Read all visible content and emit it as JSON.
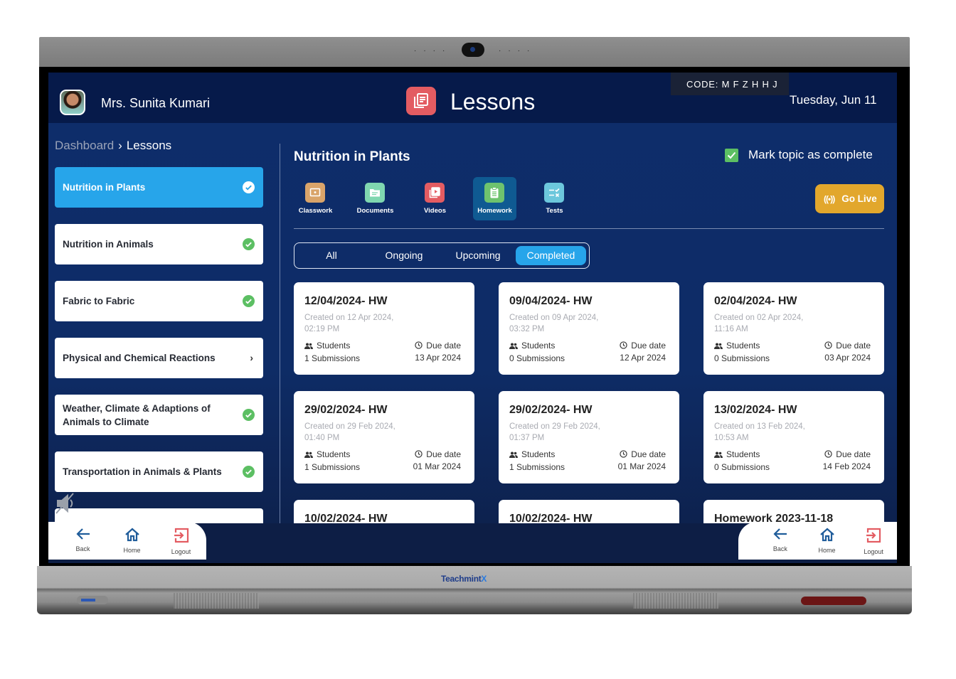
{
  "device": {
    "brand": "Teachmint",
    "brand_suffix": "X"
  },
  "header": {
    "teacher_name": "Mrs. Sunita Kumari",
    "page_title": "Lessons",
    "class_code": "CODE:  M F Z H H J",
    "date": "Tuesday, Jun 11"
  },
  "breadcrumb": {
    "root": "Dashboard",
    "separator": "›",
    "current": "Lessons"
  },
  "topics": [
    {
      "label": "Nutrition in Plants",
      "state": "completed",
      "active": true
    },
    {
      "label": "Nutrition in Animals",
      "state": "completed",
      "active": false
    },
    {
      "label": "Fabric to Fabric",
      "state": "completed",
      "active": false
    },
    {
      "label": "Physical and Chemical Reactions",
      "state": "open",
      "active": false
    },
    {
      "label": "Weather, Climate & Adaptions of Animals to Climate",
      "state": "completed",
      "active": false
    },
    {
      "label": "Transportation in Animals & Plants",
      "state": "completed",
      "active": false
    }
  ],
  "main": {
    "section_title": "Nutrition in Plants",
    "mark_complete_label": "Mark topic as complete",
    "mark_complete_checked": true,
    "go_live_label": "Go Live",
    "resource_tabs": [
      {
        "label": "Classwork",
        "icon": "classwork-icon",
        "color": "#d9a46a",
        "active": false
      },
      {
        "label": "Documents",
        "icon": "documents-icon",
        "color": "#7fd7b0",
        "active": false
      },
      {
        "label": "Videos",
        "icon": "videos-icon",
        "color": "#e35c62",
        "active": false
      },
      {
        "label": "Homework",
        "icon": "homework-icon",
        "color": "#6ec36e",
        "active": true
      },
      {
        "label": "Tests",
        "icon": "tests-icon",
        "color": "#6cc7dc",
        "active": false
      }
    ],
    "filters": [
      {
        "label": "All",
        "active": false
      },
      {
        "label": "Ongoing",
        "active": false
      },
      {
        "label": "Upcoming",
        "active": false
      },
      {
        "label": "Completed",
        "active": true
      }
    ],
    "students_label": "Students",
    "due_label": "Due date",
    "cards": [
      {
        "title": "12/04/2024- HW",
        "created": "Created on 12 Apr 2024, 02:19 PM",
        "submissions": "1 Submissions",
        "due": "13 Apr 2024"
      },
      {
        "title": "09/04/2024- HW",
        "created": "Created on 09 Apr 2024, 03:32 PM",
        "submissions": "0 Submissions",
        "due": "12 Apr 2024"
      },
      {
        "title": "02/04/2024- HW",
        "created": "Created on 02 Apr 2024, 11:16 AM",
        "submissions": "0 Submissions",
        "due": "03 Apr 2024"
      },
      {
        "title": "29/02/2024- HW",
        "created": "Created on 29 Feb 2024, 01:40 PM",
        "submissions": "1 Submissions",
        "due": "01 Mar 2024"
      },
      {
        "title": "29/02/2024- HW",
        "created": "Created on 29 Feb 2024, 01:37 PM",
        "submissions": "1 Submissions",
        "due": "01 Mar 2024"
      },
      {
        "title": "13/02/2024- HW",
        "created": "Created on 13 Feb 2024, 10:53 AM",
        "submissions": "0 Submissions",
        "due": "14 Feb 2024"
      },
      {
        "title": "10/02/2024- HW"
      },
      {
        "title": "10/02/2024- HW"
      },
      {
        "title": "Homework 2023-11-18"
      }
    ]
  },
  "nav": {
    "back": "Back",
    "home": "Home",
    "logout": "Logout"
  },
  "colors": {
    "accent": "#27a5ea",
    "success": "#5cbf63",
    "live": "#e2a72c",
    "header_bg": "#061a4a",
    "logout": "#e35c62"
  }
}
